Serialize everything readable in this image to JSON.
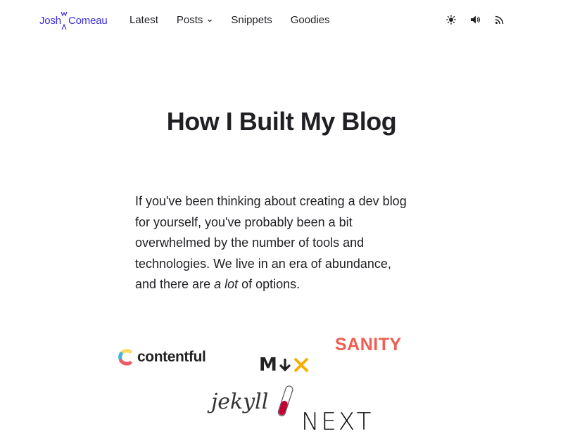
{
  "header": {
    "logo_first": "Josh",
    "logo_last": "Comeau",
    "nav": [
      {
        "label": "Latest"
      },
      {
        "label": "Posts"
      },
      {
        "label": "Snippets"
      },
      {
        "label": "Goodies"
      }
    ],
    "actions": [
      {
        "icon": "sun-icon"
      },
      {
        "icon": "speaker-icon"
      },
      {
        "icon": "rss-icon"
      }
    ]
  },
  "article": {
    "title": "How I Built My Blog",
    "intro_part1": "If you've been thinking about creating a dev blog for yourself, you've probably been a bit overwhelmed by the number of tools and technologies. We live in an era of abundance, and there are ",
    "intro_em": "a lot",
    "intro_part2": " of options."
  },
  "logos": {
    "contentful": "contentful",
    "mdx": "M",
    "sanity": "SANITY",
    "jekyll": "jekyll",
    "next": "NEXT"
  },
  "colors": {
    "brand": "#3a2ee0",
    "text": "#1f1f24",
    "sanity": "#f05d52",
    "mdx_accent": "#f9ac00"
  }
}
